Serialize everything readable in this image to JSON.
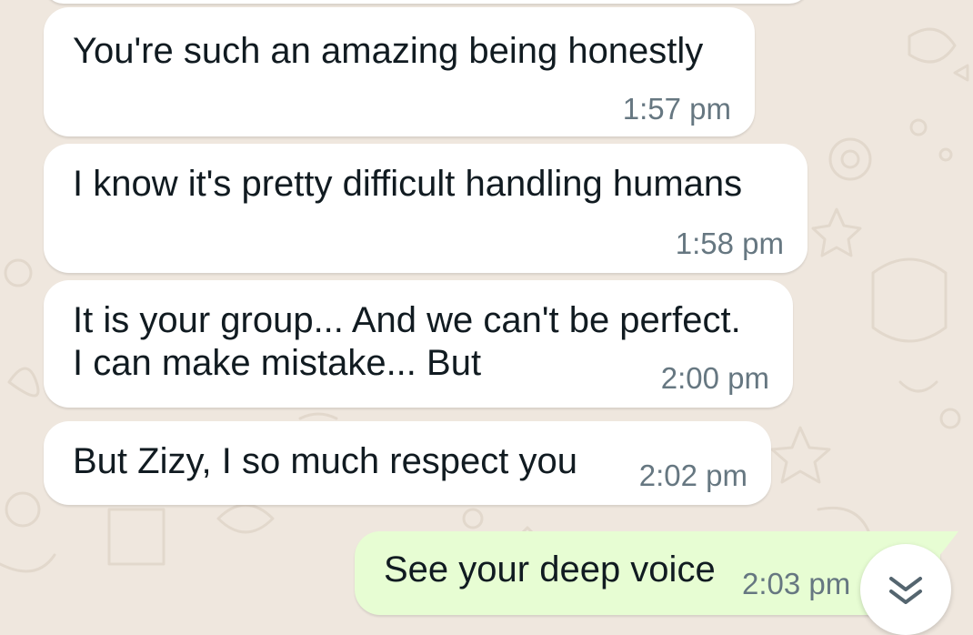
{
  "colors": {
    "wallpaper": "#efe7de",
    "incoming_bubble": "#ffffff",
    "outgoing_bubble": "#e7fdd3",
    "text": "#111b21",
    "timestamp": "#667781"
  },
  "messages": [
    {
      "direction": "incoming",
      "text": "You're such an amazing being honestly",
      "time": "1:57 pm"
    },
    {
      "direction": "incoming",
      "text": "I know it's pretty difficult handling humans",
      "time": "1:58 pm"
    },
    {
      "direction": "incoming",
      "lines": [
        "It is your group... And we can't be perfect.",
        "I can make mistake... But"
      ],
      "time": "2:00 pm"
    },
    {
      "direction": "incoming",
      "text": "But Zizy, I so much respect you",
      "time": "2:02 pm"
    },
    {
      "direction": "outgoing",
      "text": "See your deep voice",
      "time": "2:03 pm"
    }
  ],
  "scroll_button": {
    "icon": "double-chevron-down-icon"
  }
}
